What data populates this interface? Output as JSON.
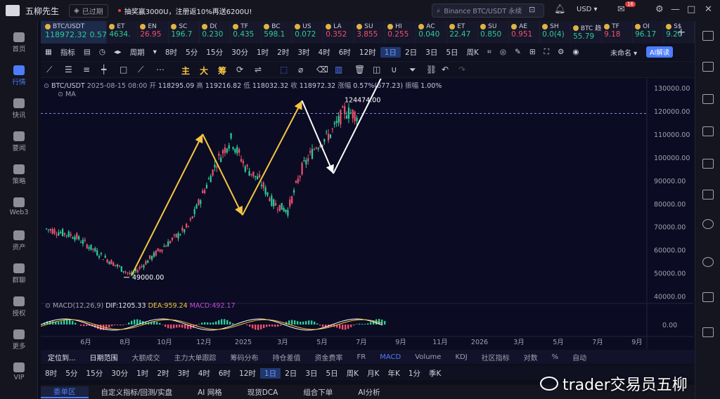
{
  "titlebar": {
    "app_name": "五柳先生",
    "expired": "已过期",
    "promo": "抽奖赢3000U，注册返10%再送6200U!",
    "search_placeholder": "Binance BTC/USDT 永续",
    "currency": "USD",
    "notification_count": "16"
  },
  "leftnav": [
    {
      "label": "首页",
      "icon": "home-icon",
      "active": false
    },
    {
      "label": "行情",
      "icon": "chart-bars-icon",
      "active": true
    },
    {
      "label": "快讯",
      "icon": "news-flash-icon",
      "active": false
    },
    {
      "label": "要闻",
      "icon": "newspaper-icon",
      "active": false
    },
    {
      "label": "策略",
      "icon": "strategy-icon",
      "active": false
    },
    {
      "label": "Web3",
      "icon": "web3-icon",
      "active": false
    },
    {
      "label": "资产",
      "icon": "wallet-icon",
      "active": false
    },
    {
      "label": "群聊",
      "icon": "chat-icon",
      "active": false
    },
    {
      "label": "授权",
      "icon": "key-icon",
      "active": false
    },
    {
      "label": "更多",
      "icon": "more-grid-icon",
      "active": false
    },
    {
      "label": "VIP",
      "icon": "vip-diamond-icon",
      "active": false
    }
  ],
  "tickers": [
    {
      "name": "BTC/USDT",
      "price": "118972.32",
      "change": "0.57%",
      "dir": "up"
    },
    {
      "name": "ET",
      "price": "4634.",
      "dir": "up"
    },
    {
      "name": "EN",
      "price": "26.95",
      "dir": "dn"
    },
    {
      "name": "SC",
      "price": "196.7",
      "dir": "up"
    },
    {
      "name": "D(",
      "price": "0.230",
      "dir": "up"
    },
    {
      "name": "TF",
      "price": "0.435",
      "dir": "up"
    },
    {
      "name": "BC",
      "price": "598.1",
      "dir": "up"
    },
    {
      "name": "US",
      "price": "0.072",
      "dir": "up"
    },
    {
      "name": "LA",
      "price": "0.352",
      "dir": "dn"
    },
    {
      "name": "SU",
      "price": "3.855",
      "dir": "dn"
    },
    {
      "name": "HI",
      "price": "0.255",
      "dir": "dn"
    },
    {
      "name": "AC",
      "price": "0.040",
      "dir": "up"
    },
    {
      "name": "ET",
      "price": "22.47",
      "dir": "up"
    },
    {
      "name": "SU",
      "price": "0.850",
      "dir": "up"
    },
    {
      "name": "AE",
      "price": "0.951",
      "dir": "dn"
    },
    {
      "name": "SH",
      "price": "0.0(4)",
      "dir": "up"
    },
    {
      "name": "BTC 趋",
      "price": "55.79",
      "dir": "up"
    },
    {
      "name": "TF",
      "price": "9.18",
      "dir": "dn"
    },
    {
      "name": "OI",
      "price": "96.17",
      "dir": "up"
    },
    {
      "name": "S$",
      "price": "9.20",
      "dir": "up"
    }
  ],
  "toolbar1": {
    "items": [
      "指标",
      "周期",
      "8时",
      "5分",
      "15分",
      "30分",
      "1时",
      "2时",
      "3时",
      "4时",
      "6时",
      "12时",
      "1日",
      "2日",
      "3日",
      "5日",
      "周K"
    ],
    "selected": "1日",
    "layout_name": "未命名",
    "ai_button": "AI解读"
  },
  "toolbar2": {
    "labels": [
      "主",
      "大",
      "筹"
    ]
  },
  "chart_info": {
    "symbol": "BTC/USDT",
    "date": "2025-08-15 08:00",
    "open_label": "开",
    "open": "118295.09",
    "high_label": "高",
    "high": "119216.82",
    "low_label": "低",
    "low": "118032.32",
    "close_label": "收",
    "close": "118972.32",
    "change_label": "涨幅",
    "change": "0.57%(677.23)",
    "amp_label": "振幅",
    "amp": "1.00%",
    "ma_label": "MA",
    "macd_label": "MACD(12,26,9)",
    "dif": "DIF:1205.33",
    "dea": "DEA:959.24",
    "macd": "MACD:492.17"
  },
  "chart_data": {
    "type": "line",
    "x_labels": [
      "6月",
      "8月",
      "10月",
      "12月",
      "2025",
      "3月",
      "5月",
      "7月",
      "9月",
      "11月",
      "2026",
      "3月",
      "5月",
      "7月",
      "9月"
    ],
    "y_ticks": [
      130000,
      120000,
      110000,
      100000,
      90000,
      80000,
      70000,
      60000,
      50000,
      40000
    ],
    "y_tick_labels": [
      "130000.00",
      "120000.00",
      "110000.00",
      "100000.00",
      "90000.00",
      "80000.00",
      "70000.00",
      "60000.00",
      "50000.00",
      "40000.00"
    ],
    "ylim": [
      38000,
      134000
    ],
    "current_price": 118972.32,
    "annotations": [
      {
        "label": "124474.00",
        "price": 124474
      },
      {
        "label": "49000.00",
        "price": 49000
      }
    ],
    "trend_arrows": [
      {
        "color": "#f5c542",
        "from": [
          8.0,
          49000
        ],
        "to": [
          13.0,
          110000
        ]
      },
      {
        "color": "#f5c542",
        "from": [
          13.0,
          110000
        ],
        "to": [
          15.8,
          75000
        ]
      },
      {
        "color": "#f5c542",
        "from": [
          15.8,
          75000
        ],
        "to": [
          20.0,
          124474
        ]
      },
      {
        "color": "#ffffff",
        "from": [
          20.0,
          124474
        ],
        "to": [
          22.2,
          93000
        ]
      },
      {
        "color": "#ffffff",
        "from": [
          22.2,
          93000
        ],
        "to": [
          26.2,
          142000
        ]
      }
    ],
    "macd_zero_label": "0.00",
    "grid": false
  },
  "bottomtabs": [
    "定位到...",
    "日期范围",
    "大额成交",
    "主力大单跟踪",
    "筹码分布",
    "持仓差值",
    "资金费率",
    "FR",
    "MACD",
    "Volume",
    "KDJ",
    "社区指标",
    "对数",
    "%",
    "自动"
  ],
  "tfbar": [
    "8时",
    "5分",
    "15分",
    "30分",
    "1时",
    "2时",
    "3时",
    "4时",
    "6时",
    "12时",
    "1日",
    "2日",
    "3日",
    "5日",
    "周K",
    "月K",
    "年K",
    "1分",
    "季K"
  ],
  "tfbar_selected": "1日",
  "panelbar": [
    "委单区",
    "自定义指标/回测/实盘",
    "AI 网格",
    "现货DCA",
    "组合下单",
    "AI分析"
  ],
  "panelbar_selected": "委单区",
  "watermark": "trader交易员五柳"
}
